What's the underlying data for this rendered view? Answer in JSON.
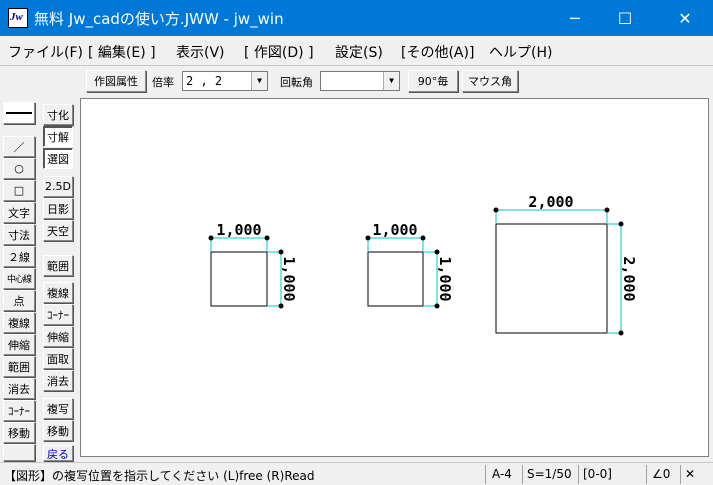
{
  "window": {
    "app_icon": "Jw",
    "title": "無料 Jw_cadの使い方.JWW - jw_win",
    "min": "─",
    "max": "☐",
    "close": "✕"
  },
  "menu": [
    "ファイル(F)",
    "[ 編集(E) ]",
    "表示(V)",
    "[ 作図(D) ]",
    "設定(S)",
    "[その他(A)]",
    "ヘルプ(H)"
  ],
  "toolbar": {
    "attr_button": "作図属性",
    "scale_label": "倍率",
    "scale_value": "2 , 2",
    "rotation_label": "回転角",
    "rotation_value": "",
    "deg90_button": "90°毎",
    "mouse_angle_button": "マウス角"
  },
  "left_palette_1": [
    "／",
    "○",
    "□",
    "文字",
    "寸法",
    "２線",
    "中心線",
    "点",
    "複線",
    "伸縮",
    "範囲",
    "消去",
    "ｺｰﾅｰ",
    "移動"
  ],
  "left_palette_2": [
    "寸化",
    "寸解",
    "選図",
    "2.5D",
    "日影",
    "天空",
    "範囲",
    "複線",
    "ｺｰﾅｰ",
    "伸縮",
    "面取",
    "消去",
    "複写",
    "移動",
    "戻る"
  ],
  "drawing": {
    "dim1": "1,000",
    "dim1v": "1,000",
    "dim2": "1,000",
    "dim2v": "1,000",
    "dim3": "2,000",
    "dim3v": "2,000"
  },
  "status": {
    "message": "【図形】の複写位置を指示してください (L)free (R)Read",
    "paper": "A-4",
    "scale": "S=1/50",
    "layer": "[0-0]",
    "angle": "∠0",
    "close": "✕"
  },
  "colors": {
    "titlebar": "#0078d7",
    "dimension_line": "#00c8c8",
    "canvas": "#ffffff"
  }
}
